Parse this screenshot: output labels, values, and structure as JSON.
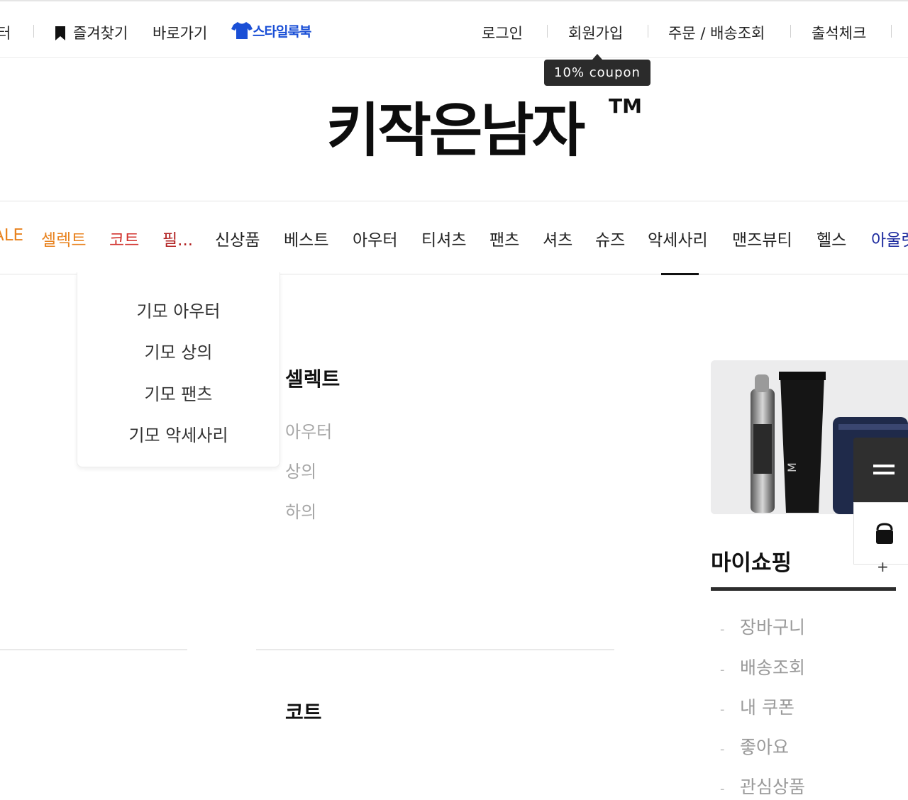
{
  "topbar": {
    "left_fragment": "터",
    "bookmark_label": "즐겨찾기",
    "shortcut_label": "바로가기",
    "stylebook_label": "스타일룩북",
    "login": "로그인",
    "signup": "회원가입",
    "orders": "주문 / 배송조회",
    "attendance": "출석체크",
    "coupon_tooltip": "10% coupon"
  },
  "logo": {
    "text": "키작은남자",
    "tm": "TM"
  },
  "nav": {
    "items": [
      {
        "label": "ALE",
        "color": "#e8821e"
      },
      {
        "label": "셀렉트",
        "color": "#e8821e"
      },
      {
        "label": "코트",
        "color": "#d2322d"
      },
      {
        "label": "필...",
        "color": "#b22222"
      },
      {
        "label": "신상품",
        "color": "#222222"
      },
      {
        "label": "베스트",
        "color": "#222222"
      },
      {
        "label": "아우터",
        "color": "#222222"
      },
      {
        "label": "티셔츠",
        "color": "#222222"
      },
      {
        "label": "팬츠",
        "color": "#222222"
      },
      {
        "label": "셔츠",
        "color": "#222222"
      },
      {
        "label": "슈즈",
        "color": "#222222"
      },
      {
        "label": "악세사리",
        "color": "#222222"
      },
      {
        "label": "맨즈뷰티",
        "color": "#222222"
      },
      {
        "label": "헬스",
        "color": "#222222"
      },
      {
        "label": "아울렛",
        "color": "#1c2a9e"
      }
    ]
  },
  "dropdown": {
    "items": [
      "기모 아우터",
      "기모 상의",
      "기모 팬츠",
      "기모 악세사리"
    ]
  },
  "content": {
    "select_title": "셀렉트",
    "select_items": [
      "아우터",
      "상의",
      "하의"
    ],
    "coat_title": "코트"
  },
  "myshopping": {
    "title": "마이쇼핑",
    "plus": "+",
    "items": [
      "장바구니",
      "배송조회",
      "내 쿠폰",
      "좋아요",
      "관심상품"
    ]
  },
  "icons": {
    "bookmark": "bookmark-icon",
    "stylebook": "tshirt-icon",
    "menu": "menu-icon",
    "cart": "shopping-bag-icon"
  }
}
